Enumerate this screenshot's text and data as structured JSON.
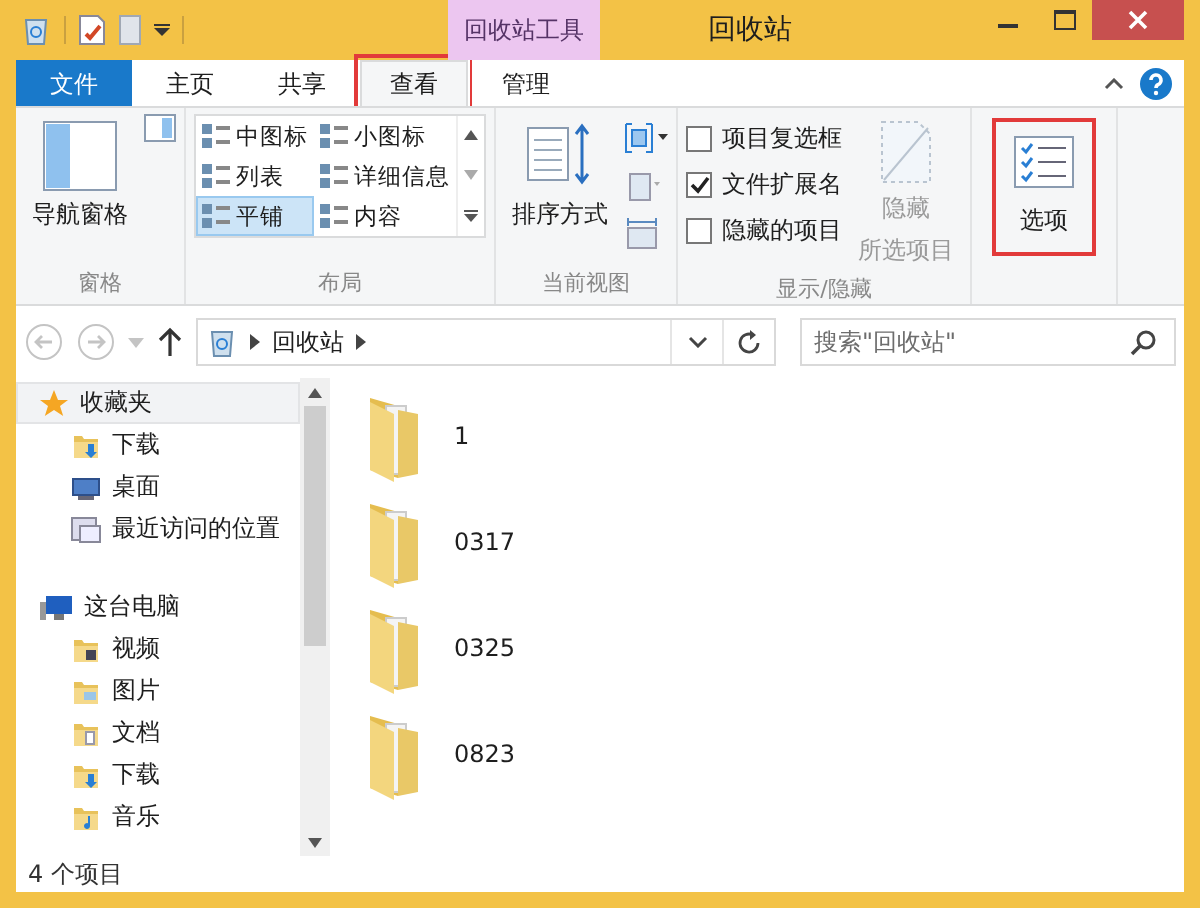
{
  "window": {
    "title": "回收站",
    "context_tab_group": "回收站工具"
  },
  "tabs": [
    {
      "label": "文件",
      "kind": "file",
      "selected": false,
      "highlighted": false
    },
    {
      "label": "主页",
      "kind": "normal",
      "selected": false,
      "highlighted": false
    },
    {
      "label": "共享",
      "kind": "normal",
      "selected": false,
      "highlighted": false
    },
    {
      "label": "查看",
      "kind": "normal",
      "selected": true,
      "highlighted": true
    },
    {
      "label": "管理",
      "kind": "context",
      "selected": false,
      "highlighted": false
    }
  ],
  "ribbon_groups": [
    {
      "kind": "pane",
      "label": "窗格",
      "button": {
        "label": "导航窗格"
      }
    },
    {
      "kind": "layout",
      "label": "布局",
      "items": [
        {
          "label": "中图标",
          "selected": false
        },
        {
          "label": "小图标",
          "selected": false
        },
        {
          "label": "列表",
          "selected": false
        },
        {
          "label": "详细信息",
          "selected": false
        },
        {
          "label": "平铺",
          "selected": true
        },
        {
          "label": "内容",
          "selected": false
        }
      ]
    },
    {
      "kind": "view",
      "label": "当前视图",
      "button": {
        "label": "排序方式"
      }
    },
    {
      "kind": "showhide",
      "label": "显示/隐藏",
      "checkboxes": [
        {
          "label": "项目复选框",
          "checked": false
        },
        {
          "label": "文件扩展名",
          "checked": true
        },
        {
          "label": "隐藏的项目",
          "checked": false
        }
      ],
      "button": {
        "label_lines": [
          "隐藏",
          "所选项目"
        ],
        "disabled": true
      }
    },
    {
      "kind": "options",
      "button": {
        "label": "选项",
        "highlighted": true
      }
    }
  ],
  "nav_buttons": [
    {
      "kind": "back",
      "disabled": true
    },
    {
      "kind": "forward",
      "disabled": true
    },
    {
      "kind": "recent",
      "disabled": true
    },
    {
      "kind": "up",
      "disabled": false
    }
  ],
  "address": {
    "segments": [
      "回收站"
    ]
  },
  "search": {
    "placeholder": "搜索\"回收站\""
  },
  "sidebar": {
    "sections": [
      {
        "label": "收藏夹",
        "kind": "star",
        "selected": true,
        "children": [
          {
            "label": "下载",
            "kind": "download",
            "selected": false
          },
          {
            "label": "桌面",
            "kind": "desktop",
            "selected": false
          },
          {
            "label": "最近访问的位置",
            "kind": "recent",
            "selected": false
          }
        ]
      },
      {
        "label": "这台电脑",
        "kind": "computer",
        "selected": false,
        "children": [
          {
            "label": "视频",
            "kind": "video",
            "selected": false
          },
          {
            "label": "图片",
            "kind": "picture",
            "selected": false
          },
          {
            "label": "文档",
            "kind": "document",
            "selected": false
          },
          {
            "label": "下载",
            "kind": "download",
            "selected": false
          },
          {
            "label": "音乐",
            "kind": "music",
            "selected": false
          }
        ]
      }
    ]
  },
  "files": [
    {
      "name": "1"
    },
    {
      "name": "0317"
    },
    {
      "name": "0325"
    },
    {
      "name": "0823"
    }
  ],
  "status_bar": {
    "text": "4 个项目"
  }
}
